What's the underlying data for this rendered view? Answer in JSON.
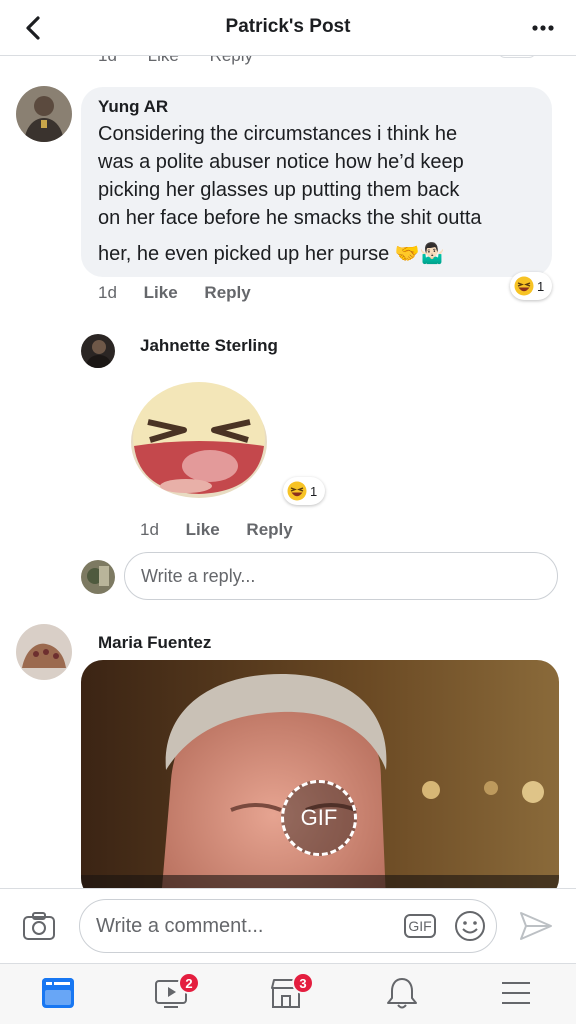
{
  "header": {
    "title": "Patrick's Post"
  },
  "partial_comment": {
    "time": "1d",
    "like": "Like",
    "reply": "Reply"
  },
  "comments": [
    {
      "author": "Yung AR",
      "text_line1": "Considering the circumstances i think he",
      "text_line2": "was a polite abuser notice how he’d keep",
      "text_line3": "picking her glasses up putting them back",
      "text_line4": "on her face before he smacks the shit outta",
      "text_line5": "her, he even picked up her purse",
      "emojis": "🤝🤷🏻‍♂️",
      "reaction": {
        "icon": "laughing-emoji",
        "count": "1"
      },
      "time": "1d",
      "like": "Like",
      "reply": "Reply"
    },
    {
      "author": "Jahnette Sterling",
      "sticker": "laughing-sticker",
      "reaction": {
        "icon": "laughing-emoji",
        "count": "1"
      },
      "time": "1d",
      "like": "Like",
      "reply": "Reply"
    },
    {
      "author": "Maria Fuentez",
      "media_label": "GIF"
    }
  ],
  "reply_placeholder": "Write a reply...",
  "composer": {
    "placeholder": "Write a comment...",
    "gif_label": "GIF"
  },
  "tabbar": {
    "tabs": [
      {
        "name": "news-feed",
        "badge": ""
      },
      {
        "name": "watch",
        "badge": "2"
      },
      {
        "name": "marketplace",
        "badge": "3"
      },
      {
        "name": "notifications",
        "badge": ""
      },
      {
        "name": "menu",
        "badge": ""
      }
    ]
  },
  "colors": {
    "accent": "#1877f2",
    "badge": "#e41e3f",
    "bubble": "#f0f2f5",
    "secondary_text": "#65676b"
  }
}
